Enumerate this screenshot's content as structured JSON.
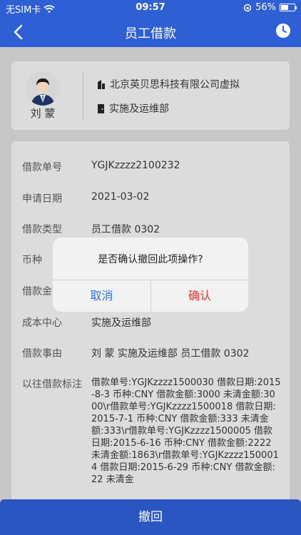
{
  "status_bar": {
    "carrier": "无SIM卡",
    "time": "09:57",
    "battery_percent": "56%",
    "battery_level": 0.56
  },
  "nav": {
    "title": "员工借款"
  },
  "user": {
    "name": "刘 蒙",
    "company": "北京英贝思科技有限公司虚拟",
    "department": "实施及运维部"
  },
  "details": {
    "rows": [
      {
        "label": "借款单号",
        "value": "YGJKzzzz2100232"
      },
      {
        "label": "申请日期",
        "value": "2021-03-02"
      },
      {
        "label": "借款类型",
        "value": "员工借款 0302"
      },
      {
        "label": "币种",
        "value": ""
      },
      {
        "label": "借款金额",
        "value": ""
      },
      {
        "label": "成本中心",
        "value": "实施及运维部"
      },
      {
        "label": "借款事由",
        "value": "刘 蒙 实施及运维部 员工借款 0302"
      }
    ],
    "history_label": "以往借款标注",
    "history_text": "借款单号:YGJKzzzz1500030 借款日期:2015-8-3 币种:CNY 借款金额:3000 未清金额:3000\\r借款单号:YGJKzzzz1500018 借款日期:2015-7-1 币种:CNY 借款金额:333 未清金额:333\\r借款单号:YGJKzzzz1500005 借款日期:2015-6-16 币种:CNY 借款金额:2222 未清金额:1863\\r借款单号:YGJKzzzz1500014 借款日期:2015-6-29 币种:CNY 借款金额:22 未清金"
  },
  "footer": {
    "withdraw_label": "撤回"
  },
  "alert": {
    "message": "是否确认撤回此项操作?",
    "cancel_label": "取消",
    "confirm_label": "确认",
    "cancel_color": "#2f6fe8",
    "confirm_color": "#e8322c"
  },
  "colors": {
    "primary": "#2f5fd4"
  }
}
